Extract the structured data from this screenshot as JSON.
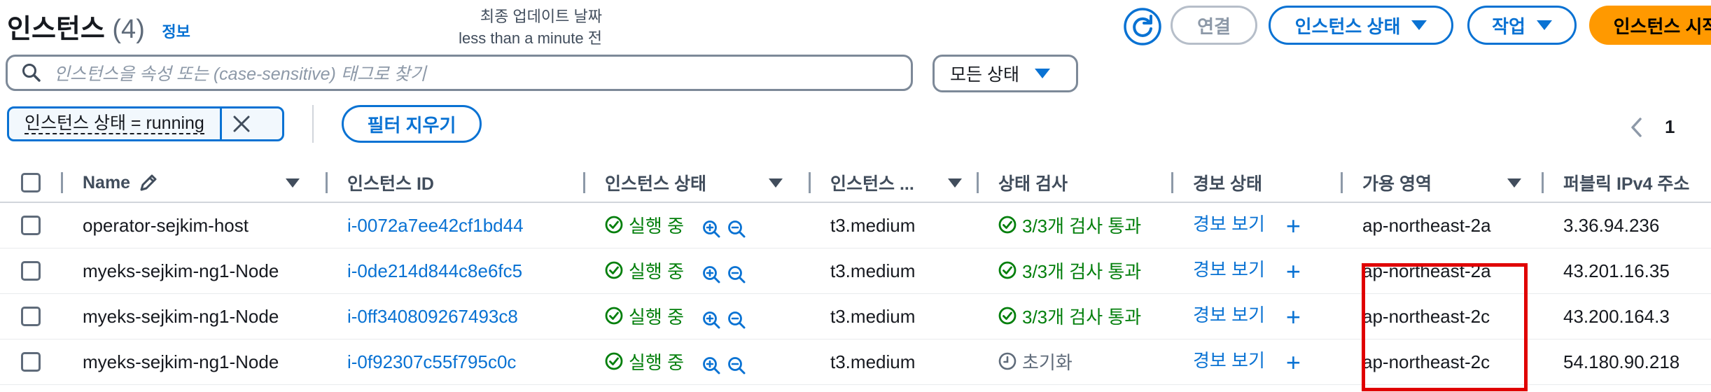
{
  "header": {
    "title": "인스턴스",
    "count": "(4)",
    "info": "정보",
    "updated_label": "최종 업데이트 날짜",
    "updated_value": "less than a minute 전"
  },
  "actions": {
    "connect": "연결",
    "instance_state": "인스턴스 상태",
    "actions": "작업",
    "launch": "인스턴스 시작"
  },
  "search": {
    "placeholder": "인스턴스을 속성 또는 (case-sensitive) 태그로 찾기"
  },
  "state_filter": {
    "selected": "모든 상태"
  },
  "filter_token": "인스턴스 상태 = running",
  "clear_filters": "필터 지우기",
  "pagination": {
    "current": "1"
  },
  "columns": [
    "Name",
    "인스턴스 ID",
    "인스턴스 상태",
    "인스턴스 ...",
    "상태 검사",
    "경보 상태",
    "가용 영역",
    "퍼블릭 IPv4 주소"
  ],
  "rows": [
    {
      "name": "operator-sejkim-host",
      "id": "i-0072a7ee42cf1bd44",
      "state": "실행 중",
      "type": "t3.medium",
      "check": "3/3개 검사 통과",
      "alarm": "경보 보기",
      "az": "ap-northeast-2a",
      "ip": "3.36.94.236"
    },
    {
      "name": "myeks-sejkim-ng1-Node",
      "id": "i-0de214d844c8e6fc5",
      "state": "실행 중",
      "type": "t3.medium",
      "check": "3/3개 검사 통과",
      "alarm": "경보 보기",
      "az": "ap-northeast-2a",
      "ip": "43.201.16.35"
    },
    {
      "name": "myeks-sejkim-ng1-Node",
      "id": "i-0ff340809267493c8",
      "state": "실행 중",
      "type": "t3.medium",
      "check": "3/3개 검사 통과",
      "alarm": "경보 보기",
      "az": "ap-northeast-2c",
      "ip": "43.200.164.3"
    },
    {
      "name": "myeks-sejkim-ng1-Node",
      "id": "i-0f92307c55f795c0c",
      "state": "실행 중",
      "type": "t3.medium",
      "check": "초기화",
      "alarm": "경보 보기",
      "az": "ap-northeast-2c",
      "ip": "54.180.90.218"
    }
  ],
  "row_check_status": [
    "passed",
    "passed",
    "passed",
    "initializing"
  ],
  "colors": {
    "link": "#0972d3",
    "success": "#037f0c",
    "primary": "#ff9900",
    "highlight": "#e00000"
  }
}
